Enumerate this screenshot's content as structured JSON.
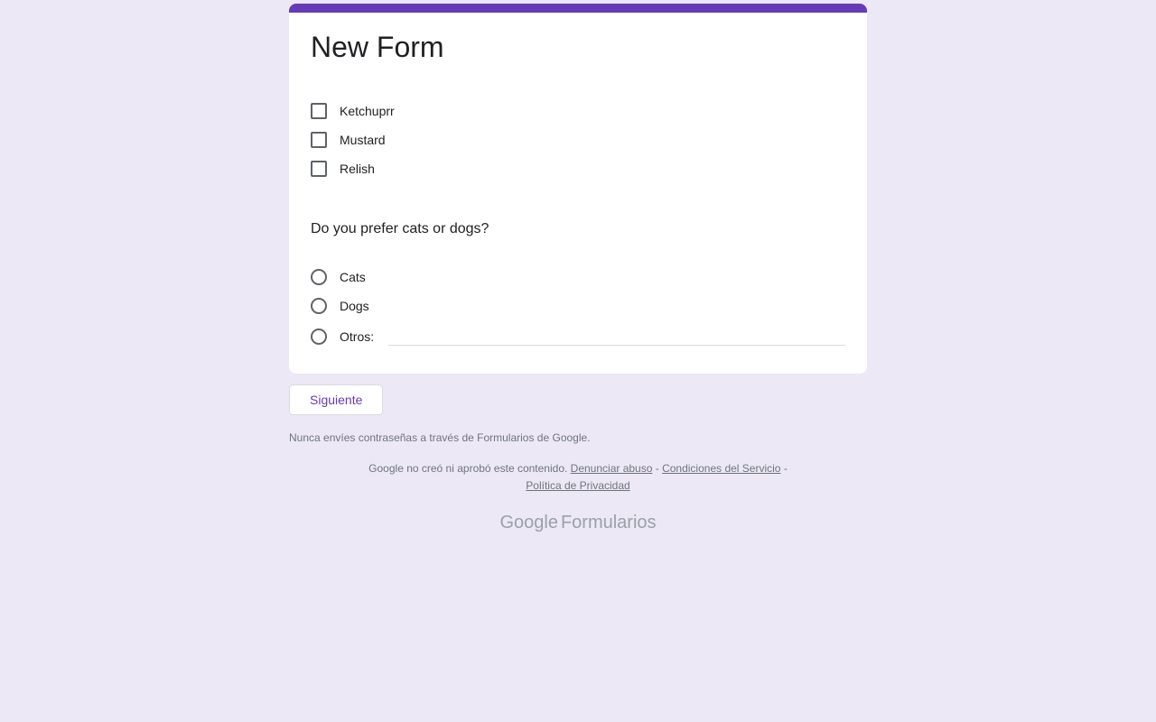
{
  "form": {
    "title": "New Form",
    "checkbox_question": {
      "options": [
        "Ketchuprr",
        "Mustard",
        "Relish"
      ]
    },
    "radio_question": {
      "title": "Do you prefer cats or dogs?",
      "options": [
        "Cats",
        "Dogs"
      ],
      "other_label": "Otros:"
    },
    "next_button": "Siguiente"
  },
  "footer": {
    "warning": "Nunca envíes contraseñas a través de Formularios de Google.",
    "disclaimer_prefix": "Google no creó ni aprobó este contenido. ",
    "report_abuse": "Denunciar abuso",
    "sep1": " - ",
    "terms": "Condiciones del Servicio",
    "sep2": " - ",
    "privacy": "Política de Privacidad",
    "logo_brand": "Google",
    "logo_product": "Formularios"
  }
}
